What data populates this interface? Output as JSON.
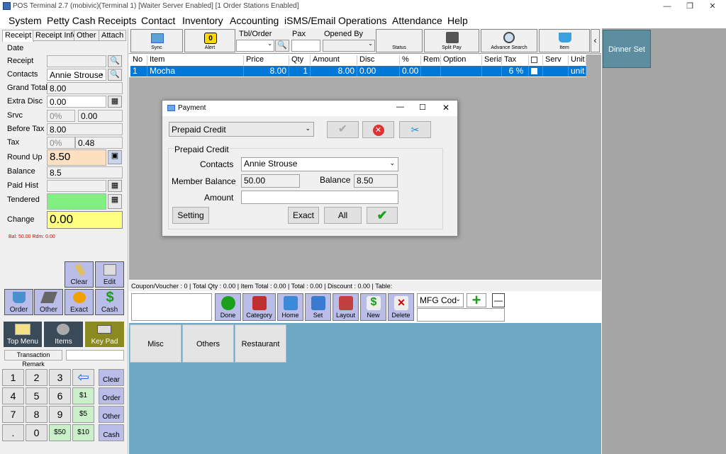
{
  "window": {
    "title": "POS Terminal 2.7 (mobivic)(Terminal 1) [Waiter Server Enabled] [1 Order Stations Enabled]",
    "controls": [
      "—",
      "❐",
      "✕"
    ]
  },
  "menu": [
    "System",
    "Petty Cash",
    "Receipts",
    "Contact",
    "Inventory",
    "Accounting",
    "iSMS/Email",
    "Operations",
    "Attendance",
    "Help"
  ],
  "left_tabs": [
    "Receipt",
    "Receipt Info",
    "Other",
    "Attach"
  ],
  "fields": {
    "date_label": "Date",
    "receipt_label": "Receipt",
    "contacts_label": "Contacts",
    "contacts_value": "Annie Strouse",
    "grand_total_label": "Grand Total",
    "grand_total_value": "8.00",
    "extra_disc_label": "Extra Disc",
    "extra_disc_value": "0.00",
    "srvc_label": "Srvc",
    "srvc_pct": "0%",
    "srvc_value": "0.00",
    "before_tax_label": "Before Tax",
    "before_tax_value": "8.00",
    "tax_label": "Tax",
    "tax_pct": "0%",
    "tax_value": "0.48",
    "round_up_label": "Round Up",
    "round_up_value": "8.50",
    "balance_label": "Balance",
    "balance_value": "8.5",
    "paid_hist_label": "Paid Hist",
    "tendered_label": "Tendered",
    "change_label": "Change",
    "change_value": "0.00",
    "bal_note": "Bal: 50.00 Rdm: 0.00"
  },
  "left_tiles": {
    "clear": "Clear",
    "edit": "Edit",
    "order": "Order",
    "other": "Other",
    "exact": "Exact",
    "cash": "Cash",
    "top_menu": "Top Menu",
    "items": "Items",
    "key_pad": "Key Pad",
    "transaction_remark": "Transaction Remark"
  },
  "keypad": {
    "rows": [
      [
        "1",
        "2",
        "3"
      ],
      [
        "4",
        "5",
        "6"
      ],
      [
        "7",
        "8",
        "9"
      ],
      [
        ".",
        "0"
      ]
    ],
    "money": [
      "$1",
      "$5",
      "$50",
      "$10"
    ],
    "side": [
      "Clear",
      "Order",
      "Other",
      "Cash"
    ]
  },
  "toolbar": {
    "sync": "Sync",
    "alert": "Alert",
    "alert_count": "0",
    "tbl_order": "Tbl/Order",
    "pax": "Pax",
    "opened_by": "Opened By",
    "status": "Status",
    "split_pay": "Split Pay",
    "advance_search": "Advance Search",
    "item": "Item",
    "collapse": "‹"
  },
  "grid": {
    "headers": [
      "No",
      "Item",
      "Price",
      "Qty",
      "Amount",
      "Disc",
      "%",
      "Rem",
      "Option",
      "Serial",
      "Tax",
      "",
      "Serv",
      "Unit"
    ],
    "rows": [
      {
        "no": "1",
        "item": "Mocha",
        "price": "8.00",
        "qty": "1",
        "amount": "8.00",
        "disc": "0.00",
        "pct": "0.00",
        "rem": "",
        "option": "",
        "serial": "",
        "tax": "6 %",
        "serv": "",
        "unit": "unit"
      }
    ]
  },
  "statusbar": {
    "text": "Coupon/Voucher :  0 | Total Qty :  0.00 | Item Total :  0.00 | Total :  0.00 | Discount :  0.00 | Table:"
  },
  "actions": [
    "Done",
    "Category",
    "Home",
    "Set",
    "Layout",
    "New",
    "Delete"
  ],
  "mfg": {
    "value": "MFG Cod",
    "minus": "—",
    "plus": "+"
  },
  "categories": [
    "Misc",
    "Others",
    "Restaurant"
  ],
  "right_panel": {
    "dinner_set": "Dinner Set"
  },
  "dialog": {
    "title": "Payment",
    "method": "Prepaid Credit",
    "group_title": "Prepaid Credit",
    "contacts_label": "Contacts",
    "contacts_value": "Annie Strouse",
    "member_balance_label": "Member Balance",
    "member_balance_value": "50.00",
    "balance_label": "Balance",
    "balance_value": "8.50",
    "amount_label": "Amount",
    "amount_value": "",
    "setting": "Setting",
    "exact": "Exact",
    "all": "All"
  },
  "colors": {
    "selection": "#0078d7",
    "tile_blue": "#b9bde8",
    "category_bg": "#6fa8c5",
    "dinner_set": "#5d8ea0",
    "change_yellow": "#ffff80",
    "round_up_orange": "#fde0c0",
    "tendered_green": "#80f080"
  }
}
